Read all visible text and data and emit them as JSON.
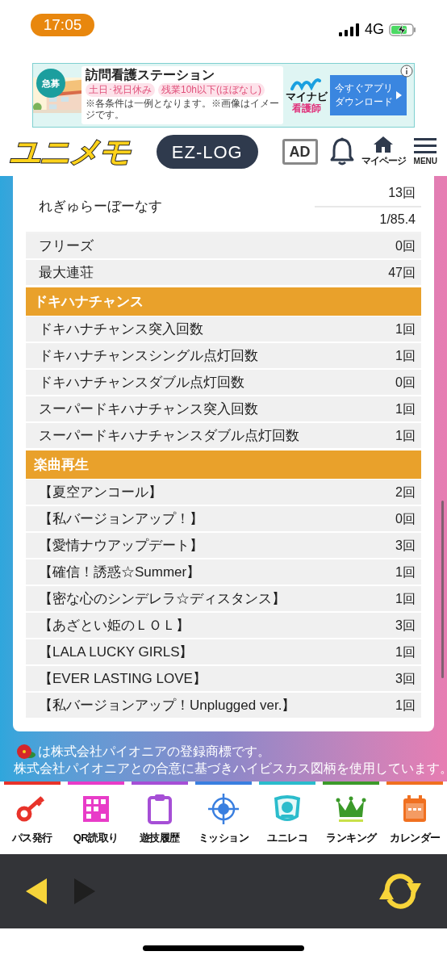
{
  "status_bar": {
    "time": "17:05",
    "network": "4G"
  },
  "ad": {
    "badge": "急募",
    "headline": "訪問看護ステーション",
    "tags": [
      "土日･祝日休み",
      "残業10h以下(ほぼなし)"
    ],
    "note": "※各条件は一例となります。※画像はイメージです。",
    "brand": "マイナビ",
    "brand_sub": "看護師",
    "cta_lines": [
      "今すぐアプリ",
      "ダウンロード"
    ]
  },
  "header": {
    "logo": "ユニメモ",
    "ez_log": "EZ-LOG",
    "ad_button": "AD",
    "mypage": "マイページ",
    "menu": "MENU"
  },
  "table": {
    "rows": [
      {
        "kind": "multi",
        "label": "れぎゅらーぼーなす",
        "values": [
          "13回",
          "1/85.4"
        ]
      },
      {
        "kind": "stat",
        "label": "フリーズ",
        "value": "0回"
      },
      {
        "kind": "stat",
        "label": "最大連荘",
        "value": "47回"
      },
      {
        "kind": "section",
        "label": "ドキハナチャンス"
      },
      {
        "kind": "stat",
        "label": "ドキハナチャンス突入回数",
        "value": "1回"
      },
      {
        "kind": "stat",
        "label": "ドキハナチャンスシングル点灯回数",
        "value": "1回"
      },
      {
        "kind": "stat",
        "label": "ドキハナチャンスダブル点灯回数",
        "value": "0回"
      },
      {
        "kind": "stat",
        "label": "スーパードキハナチャンス突入回数",
        "value": "1回"
      },
      {
        "kind": "stat",
        "label": "スーパードキハナチャンスダブル点灯回数",
        "value": "1回"
      },
      {
        "kind": "section",
        "label": "楽曲再生"
      },
      {
        "kind": "stat",
        "label": "【夏空アンコール】",
        "value": "2回"
      },
      {
        "kind": "stat",
        "label": "【私バージョンアップ！】",
        "value": "0回"
      },
      {
        "kind": "stat",
        "label": "【愛情ナウアップデート】",
        "value": "3回"
      },
      {
        "kind": "stat",
        "label": "【確信！誘惑☆Summer】",
        "value": "1回"
      },
      {
        "kind": "stat",
        "label": "【密な心のシンデレラ☆ディスタンス】",
        "value": "1回"
      },
      {
        "kind": "stat",
        "label": "【あざとい姫のＬＯＬ】",
        "value": "3回"
      },
      {
        "kind": "stat",
        "label": "【LALA LUCKY GIRLS】",
        "value": "1回"
      },
      {
        "kind": "stat",
        "label": "【EVER LASTING LOVE】",
        "value": "3回"
      },
      {
        "kind": "stat",
        "label": "【私バージョンアップ！Unplugged ver.】",
        "value": "1回"
      }
    ]
  },
  "footer_notes": [
    "は株式会社パイオニアの登録商標です。",
    "株式会社パイオニアとの合意に基づきハイビスカス図柄を使用しています。"
  ],
  "bottom_nav": [
    {
      "kind": "key",
      "label": "パス発行",
      "color": "#e8332a"
    },
    {
      "kind": "qr",
      "label": "QR読取り",
      "color": "#e83cc8"
    },
    {
      "kind": "clipboard",
      "label": "遊技履歴",
      "color": "#a64fd6"
    },
    {
      "kind": "target",
      "label": "ミッション",
      "color": "#3a7fe0"
    },
    {
      "kind": "emblem",
      "label": "ユニレコ",
      "color": "#2bbccc"
    },
    {
      "kind": "crown",
      "label": "ランキング",
      "color": "#3c9a2a"
    },
    {
      "kind": "calendar",
      "label": "カレンダー",
      "color": "#f07020"
    }
  ],
  "browser_bar": {
    "back": {
      "disabled": false
    },
    "forward": {
      "disabled": true
    }
  }
}
